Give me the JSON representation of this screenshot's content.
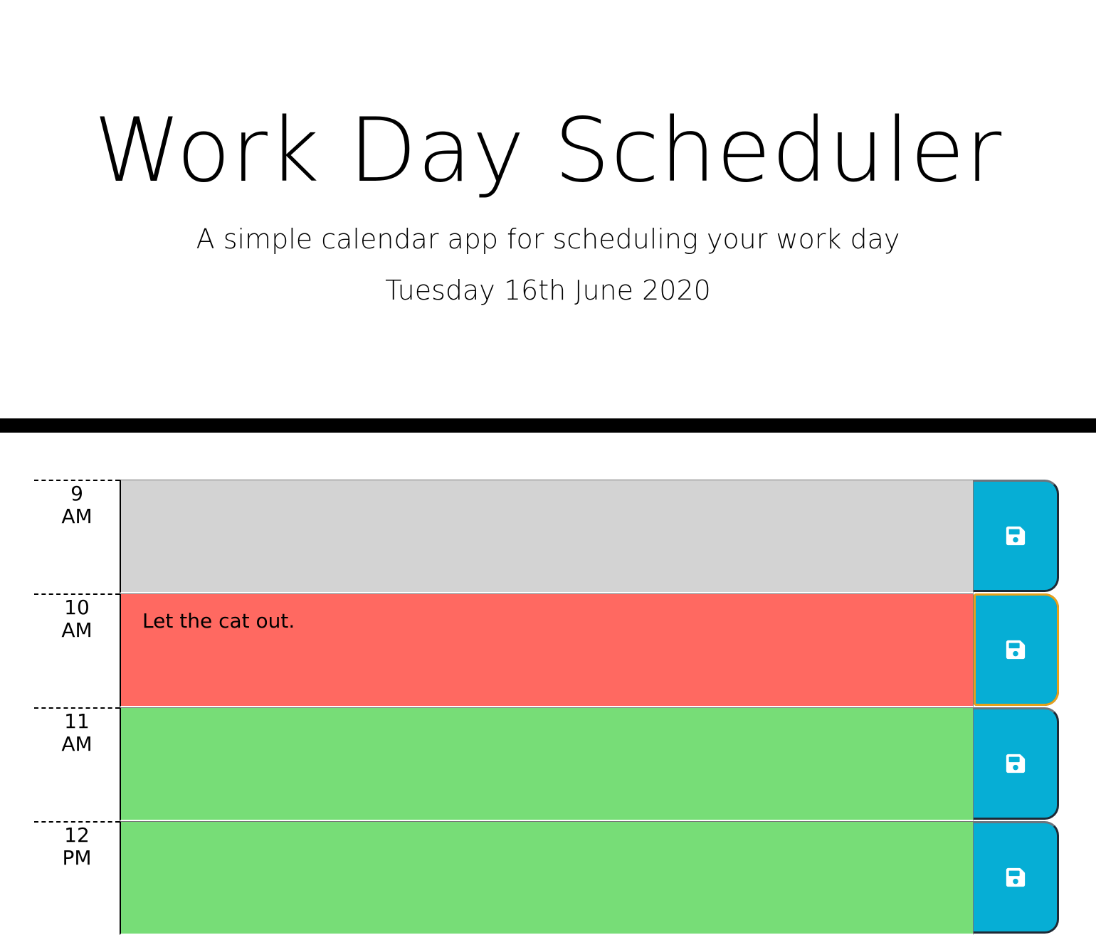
{
  "header": {
    "title": "Work Day Scheduler",
    "subtitle": "A simple calendar app for scheduling your work day",
    "current_day": "Tuesday 16th June 2020"
  },
  "timeblocks": [
    {
      "hour": "9",
      "period": "AM",
      "text": "",
      "state": "past"
    },
    {
      "hour": "10",
      "period": "AM",
      "text": "Let the cat out.",
      "state": "present"
    },
    {
      "hour": "11",
      "period": "AM",
      "text": "",
      "state": "future"
    },
    {
      "hour": "12",
      "period": "PM",
      "text": "",
      "state": "future"
    }
  ],
  "colors": {
    "past": "#d3d3d3",
    "present": "#ff6961",
    "future": "#77dd77",
    "save_button": "#06aed5",
    "focus_ring": "#e6a11a"
  },
  "icons": {
    "save": "floppy-disk-icon"
  }
}
